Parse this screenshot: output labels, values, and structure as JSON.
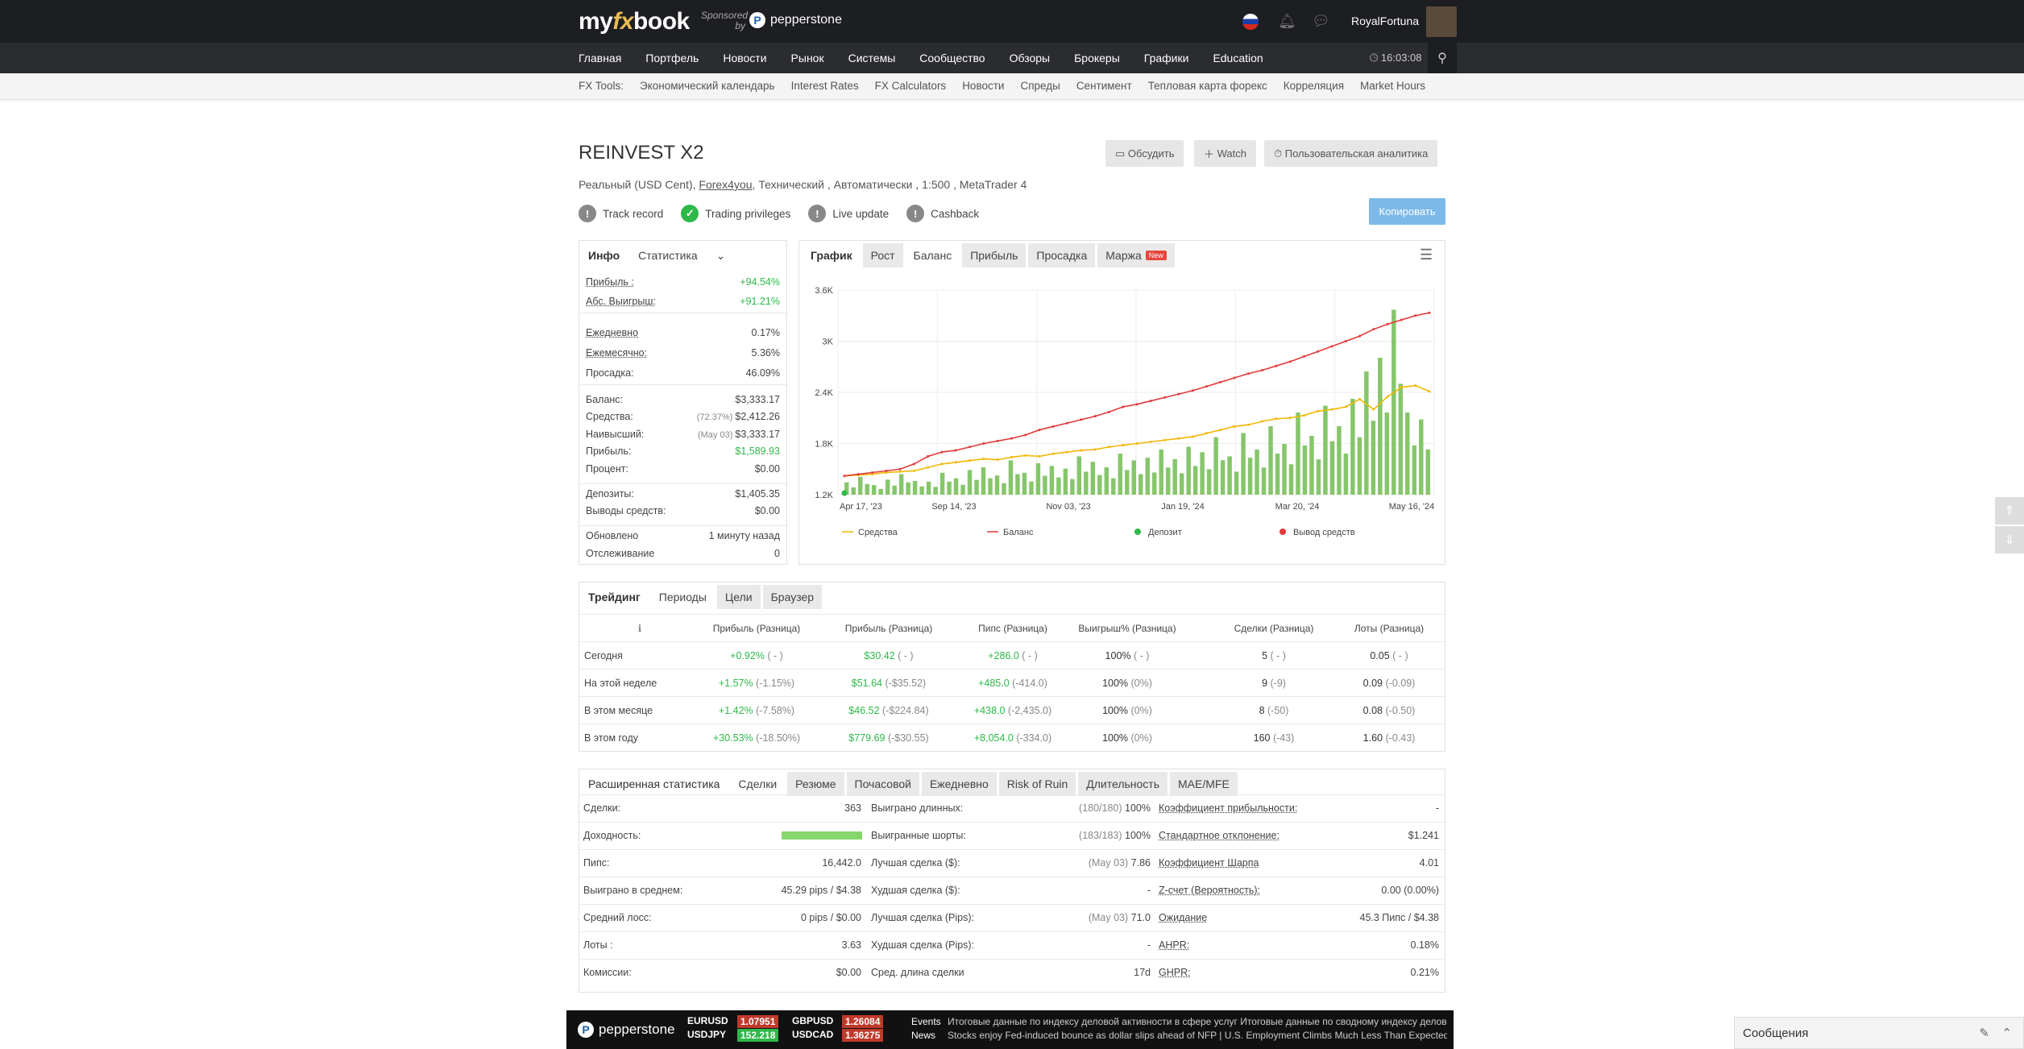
{
  "header": {
    "logo_a": "my",
    "logo_fx": "fx",
    "logo_b": "book",
    "sponsored": "Sponsored by",
    "sponsor": "pepperstone",
    "user": "RoyalFortuna"
  },
  "nav": [
    "Главная",
    "Портфель",
    "Новости",
    "Рынок",
    "Системы",
    "Сообщество",
    "Обзоры",
    "Брокеры",
    "Графики",
    "Education"
  ],
  "clock": "16:03:08",
  "tools": [
    "FX Tools:",
    "Экономический календарь",
    "Interest Rates",
    "FX Calculators",
    "Новости",
    "Спреды",
    "Сентимент",
    "Тепловая карта форекс",
    "Корреляция",
    "Market Hours"
  ],
  "title": "REINVEST X2",
  "sub_a": "Реальный (USD Cent),",
  "sub_broker": "Forex4you",
  "sub_b": ", Технический , Автоматически , 1:500 , MetaTrader 4",
  "badges": [
    {
      "icon": "!",
      "label": "Track record"
    },
    {
      "icon": "✓",
      "label": "Trading privileges"
    },
    {
      "icon": "!",
      "label": "Live update"
    },
    {
      "icon": "!",
      "label": "Cashback"
    }
  ],
  "buttons": {
    "discuss": "Обсудить",
    "watch": "Watch",
    "analytics": "Пользовательская аналитика",
    "copy": "Копировать"
  },
  "info": {
    "tab_info": "Инфо",
    "tab_stats": "Статистика",
    "rows": [
      {
        "label": "Прибыль :",
        "value": "+94.54%",
        "style": "green"
      },
      {
        "label": "Абс. Выигрыш:",
        "value": "+91.21%",
        "style": "green"
      },
      {
        "label": "Ежедневно",
        "value": "0.17%"
      },
      {
        "label": "Ежемесячно:",
        "value": "5.36%"
      },
      {
        "label": "Просадка:",
        "value": "46.09%"
      },
      {
        "label": "Баланс:",
        "value": "$3,333.17"
      },
      {
        "label": "Средства:",
        "pre": "(72.37%)",
        "value": "$2,412.26"
      },
      {
        "label": "Наивысший:",
        "pre": "(May 03)",
        "value": "$3,333.17"
      },
      {
        "label": "Прибыль:",
        "value": "$1,589.93",
        "style": "green"
      },
      {
        "label": "Процент:",
        "value": "$0.00"
      },
      {
        "label": "Депозиты:",
        "value": "$1,405.35"
      },
      {
        "label": "Выводы средств:",
        "value": "$0.00"
      },
      {
        "label": "Обновлено",
        "value": "1 минуту назад"
      },
      {
        "label": "Отслеживание",
        "value": "0"
      }
    ]
  },
  "chart_tabs": [
    "График",
    "Рост",
    "Баланс",
    "Прибыль",
    "Просадка",
    "Маржа"
  ],
  "chart_new": "New",
  "chart_data": {
    "type": "line",
    "x_ticks": [
      "Apr 17, '23",
      "Sep 14, '23",
      "Nov 03, '23",
      "Jan 19, '24",
      "Mar 20, '24",
      "May 16, '24"
    ],
    "y_ticks": [
      "1.2K",
      "1.8K",
      "2.4K",
      "3K",
      "3.6K"
    ],
    "ylim": [
      1200,
      3600
    ],
    "legend": [
      "Средства",
      "Баланс",
      "Депозит",
      "Вывод средств"
    ],
    "balance": [
      1420,
      1440,
      1460,
      1480,
      1500,
      1560,
      1650,
      1700,
      1720,
      1760,
      1800,
      1830,
      1860,
      1900,
      1960,
      2000,
      2040,
      2080,
      2120,
      2170,
      2230,
      2260,
      2300,
      2340,
      2380,
      2420,
      2470,
      2520,
      2570,
      2620,
      2660,
      2710,
      2760,
      2820,
      2880,
      2940,
      3000,
      3060,
      3140,
      3200,
      3250,
      3300,
      3333
    ],
    "equity": [
      1420,
      1430,
      1440,
      1460,
      1470,
      1480,
      1520,
      1560,
      1580,
      1600,
      1620,
      1610,
      1640,
      1660,
      1650,
      1680,
      1700,
      1720,
      1730,
      1760,
      1780,
      1800,
      1820,
      1840,
      1860,
      1880,
      1920,
      1960,
      2000,
      2020,
      2060,
      2090,
      2100,
      2130,
      2180,
      2200,
      2230,
      2320,
      2200,
      2350,
      2460,
      2480,
      2412
    ],
    "deposits": [
      90,
      130,
      70,
      110,
      150,
      100,
      95,
      160,
      120,
      180,
      200,
      140,
      250,
      160,
      230,
      210,
      190,
      280,
      240,
      200,
      300,
      250,
      270,
      330,
      260,
      350,
      310,
      420,
      280,
      450,
      330,
      500,
      370,
      600,
      430,
      650,
      500,
      700,
      900,
      1000,
      1350,
      600,
      550
    ]
  },
  "trading": {
    "tabs": [
      "Трейдинг",
      "Периоды",
      "Цели",
      "Браузер"
    ],
    "headers": [
      "Прибыль (Разница)",
      "Прибыль (Разница)",
      "Пипс (Разница)",
      "Выигрыш% (Разница)",
      "Сделки (Разница)",
      "Лоты (Разница)"
    ],
    "rows": [
      {
        "label": "Сегодня",
        "c": [
          [
            "+0.92%",
            "( - )"
          ],
          [
            "$30.42",
            "( - )"
          ],
          [
            "+286.0",
            "( - )"
          ],
          [
            "100%",
            "( - )"
          ],
          [
            "5",
            "( - )"
          ],
          [
            "0.05",
            "( - )"
          ]
        ]
      },
      {
        "label": "На этой неделе",
        "c": [
          [
            "+1.57%",
            "(-1.15%)"
          ],
          [
            "$51.64",
            "(-$35.52)"
          ],
          [
            "+485.0",
            "(-414.0)"
          ],
          [
            "100%",
            "(0%)"
          ],
          [
            "9",
            "(-9)"
          ],
          [
            "0.09",
            "(-0.09)"
          ]
        ]
      },
      {
        "label": "В этом месяце",
        "c": [
          [
            "+1.42%",
            "(-7.58%)"
          ],
          [
            "$46.52",
            "(-$224.84)"
          ],
          [
            "+438.0",
            "(-2,435.0)"
          ],
          [
            "100%",
            "(0%)"
          ],
          [
            "8",
            "(-50)"
          ],
          [
            "0.08",
            "(-0.50)"
          ]
        ]
      },
      {
        "label": "В этом году",
        "c": [
          [
            "+30.53%",
            "(-18.50%)"
          ],
          [
            "$779.69",
            "(-$30.55)"
          ],
          [
            "+8,054.0",
            "(-334.0)"
          ],
          [
            "100%",
            "(0%)"
          ],
          [
            "160",
            "(-43)"
          ],
          [
            "1.60",
            "(-0.43)"
          ]
        ]
      }
    ]
  },
  "ext": {
    "tabs": [
      "Расширенная статистика",
      "Сделки",
      "Резюме",
      "Почасовой",
      "Ежедневно",
      "Risk of Ruin",
      "Длительность",
      "MAE/MFE"
    ],
    "col1": [
      [
        "Сделки:",
        "363"
      ],
      [
        "Доходность:",
        ""
      ],
      [
        "Пипс:",
        "16,442.0"
      ],
      [
        "Выиграно в среднем:",
        "45.29 pips / $4.38"
      ],
      [
        "Средний лосс:",
        "0 pips / $0.00"
      ],
      [
        "Лоты :",
        "3.63"
      ],
      [
        "Комиссии:",
        "$0.00"
      ]
    ],
    "col2": [
      [
        "Выиграно длинных:",
        "(180/180)",
        "100%"
      ],
      [
        "Выигранные шорты:",
        "(183/183)",
        "100%"
      ],
      [
        "Лучшая сделка ($):",
        "(May 03)",
        "7.86"
      ],
      [
        "Худшая сделка ($):",
        "",
        "-"
      ],
      [
        "Лучшая сделка (Pips):",
        "(May 03)",
        "71.0"
      ],
      [
        "Худшая сделка (Pips):",
        "",
        "-"
      ],
      [
        "Сред. длина сделки",
        "",
        "17d"
      ]
    ],
    "col3": [
      [
        "Коэффициент прибыльности:",
        "-"
      ],
      [
        "Стандартное отклонение:",
        "$1.241"
      ],
      [
        "Коэффициент Шарпа",
        "4.01"
      ],
      [
        "Z-счет (Вероятность):",
        "0.00 (0.00%)"
      ],
      [
        "Ожидание",
        "45.3 Пипс / $4.38"
      ],
      [
        "AHPR:",
        "0.18%"
      ],
      [
        "GHPR:",
        "0.21%"
      ]
    ]
  },
  "ticker": {
    "brand": "pepperstone",
    "q": [
      [
        "EURUSD",
        "1.07951"
      ],
      [
        "GBPUSD",
        "1.26084"
      ],
      [
        "USDJPY",
        "152.218"
      ],
      [
        "USDCAD",
        "1.36275"
      ]
    ],
    "events": "Events",
    "news": "News",
    "line1": "Итоговые данные по индексу деловой активности в сфере услуг",
    "line1b": "Итоговые данные по сводному индексу деловой ак",
    "line2": "Stocks enjoy Fed-induced bounce as dollar slips ahead of NFP | U.S. Employment Climbs Much Less Than Expected In"
  },
  "messages": "Сообщения"
}
